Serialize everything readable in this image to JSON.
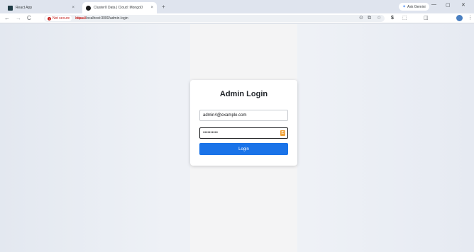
{
  "browser": {
    "tabs": [
      {
        "title": "React App",
        "close": "×"
      },
      {
        "title": "Cluster0 Data | Cloud: MongoD",
        "close": "×"
      }
    ],
    "new_tab": "+",
    "gemini_label": "Ask Gemini",
    "window": {
      "minimize": "—",
      "restore": "▢",
      "close": "✕"
    },
    "nav": {
      "back": "←",
      "forward": "→",
      "reload": "C"
    },
    "security_chip": "Not secure",
    "url_scheme": "https://",
    "url_rest": "localhost:3000/admin-login",
    "toolbar_icons": {
      "location": "⊙",
      "cast": "⧉",
      "star": "☆",
      "dollar": "$",
      "extensions": "⬚",
      "sidebar": "◫",
      "menu": "⋮"
    }
  },
  "login": {
    "title": "Admin Login",
    "email_value": "admin4@example.com",
    "password_value": "••••••••••",
    "button_label": "Login"
  },
  "icons": {
    "lock": "key-lock-icon",
    "warning": "warning-icon"
  },
  "colors": {
    "primary_button": "#1a73e8",
    "password_manager": "#f0a33a",
    "not_secure": "#c5221f"
  }
}
